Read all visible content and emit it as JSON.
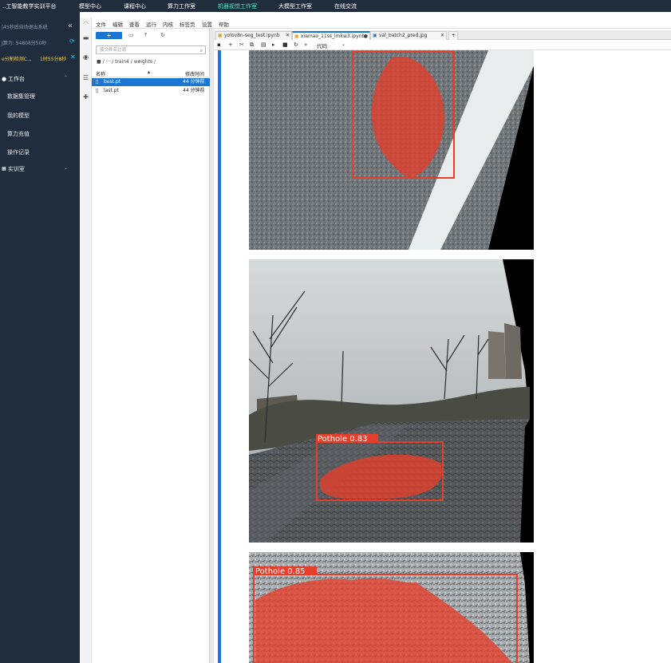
{
  "topnav": {
    "brand": "..工智能教学实训平台",
    "items": [
      "模型中心",
      "课程中心",
      "算力工作室",
      "机器视觉工作室",
      "大模型工作室",
      "在线交流"
    ],
    "active_index": 3
  },
  "sidebar": {
    "logout_notice": "|45秒后自动退出系统",
    "collapse_icon": "double-chevron-left",
    "compute_label": "J算力: 54808分50秒",
    "task_label": "e分割检测C...",
    "task_time": "1时55分8秒",
    "workspace_label": "工作台",
    "items": [
      "数据集管理",
      "我的模型",
      "算力充值",
      "操作记录"
    ],
    "training_label": "实训室"
  },
  "menubar": [
    "文件",
    "编辑",
    "查看",
    "运行",
    "内核",
    "标签页",
    "设置",
    "帮助"
  ],
  "filebrowser": {
    "new_label": "+",
    "search_placeholder": "按文件名过滤",
    "breadcrumb": "/ ··· / train4 / weights /",
    "col_name": "名称",
    "col_modified": "修改时间",
    "files": [
      {
        "name": "best.pt",
        "modified": "44 分钟前",
        "selected": true
      },
      {
        "name": "last.pt",
        "modified": "44 分钟前",
        "selected": false
      }
    ]
  },
  "tabs": [
    {
      "label": "yolov8n-seg_test.ipynb",
      "active": false
    },
    {
      "label": "xiamao_11ss_lmkw3.ipynb",
      "active": true
    },
    {
      "label": "val_batch2_pred.jpg",
      "active": false
    }
  ],
  "notebook_toolbar": {
    "cell_type": "代码"
  },
  "detections": [
    {
      "label": "Pothole 0.83"
    },
    {
      "label": "Pothole 0.85"
    }
  ],
  "colors": {
    "nav_bg": "#1f2d3d",
    "accent": "#1976d2",
    "active_nav": "#4fe3c1",
    "detection": "#e53e2a"
  }
}
